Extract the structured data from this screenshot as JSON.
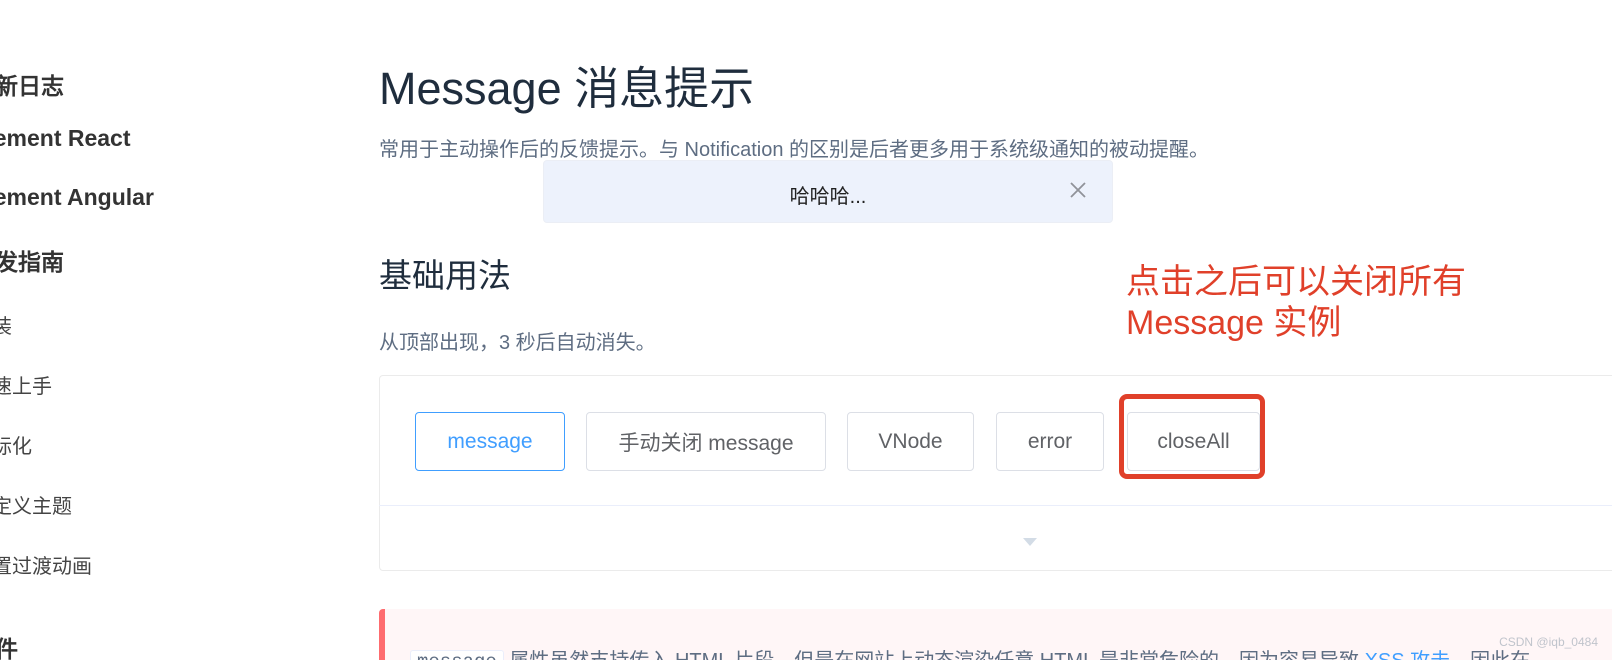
{
  "sidebar": {
    "items": [
      {
        "label": "更新日志",
        "kind": "group"
      },
      {
        "label": "Element React",
        "kind": "group"
      },
      {
        "label": "Element Angular",
        "kind": "group"
      },
      {
        "label": "开发指南",
        "kind": "group"
      },
      {
        "label": "安装",
        "kind": "sub"
      },
      {
        "label": "快速上手",
        "kind": "sub"
      },
      {
        "label": "国际化",
        "kind": "sub"
      },
      {
        "label": "自定义主题",
        "kind": "sub"
      },
      {
        "label": "内置过渡动画",
        "kind": "sub"
      },
      {
        "label": "组件",
        "kind": "group"
      }
    ]
  },
  "header": {
    "title": "Message 消息提示",
    "description": "常用于主动操作后的反馈提示。与 Notification 的区别是后者更多用于系统级通知的被动提醒。"
  },
  "toast": {
    "text": "哈哈哈...",
    "close_icon": "close-icon"
  },
  "section": {
    "title": "基础用法",
    "description": "从顶部出现，3 秒后自动消失。"
  },
  "demo": {
    "buttons": [
      {
        "label": "message",
        "style": "primary-plain"
      },
      {
        "label": "手动关闭 message",
        "style": "default"
      },
      {
        "label": "VNode",
        "style": "default"
      },
      {
        "label": "error",
        "style": "default"
      },
      {
        "label": "closeAll",
        "style": "default"
      }
    ],
    "expand_icon": "caret-down-icon"
  },
  "annotation": {
    "line1": "点击之后可以关闭所有",
    "line2": "Message 实例"
  },
  "warning": {
    "code": "message",
    "text_before": " 属性虽然支持传入 HTML 片段，但是在网站上动态渲染任意 HTML 是非常危险的，因为容易导致 ",
    "link": "XSS 攻击",
    "text_after": "，因此在"
  },
  "watermark": "CSDN @iqb_0484",
  "colors": {
    "primary": "#409eff",
    "annotation": "#e0402a",
    "toast_bg": "#edf2fc",
    "warning_border": "#fe6c6f"
  }
}
